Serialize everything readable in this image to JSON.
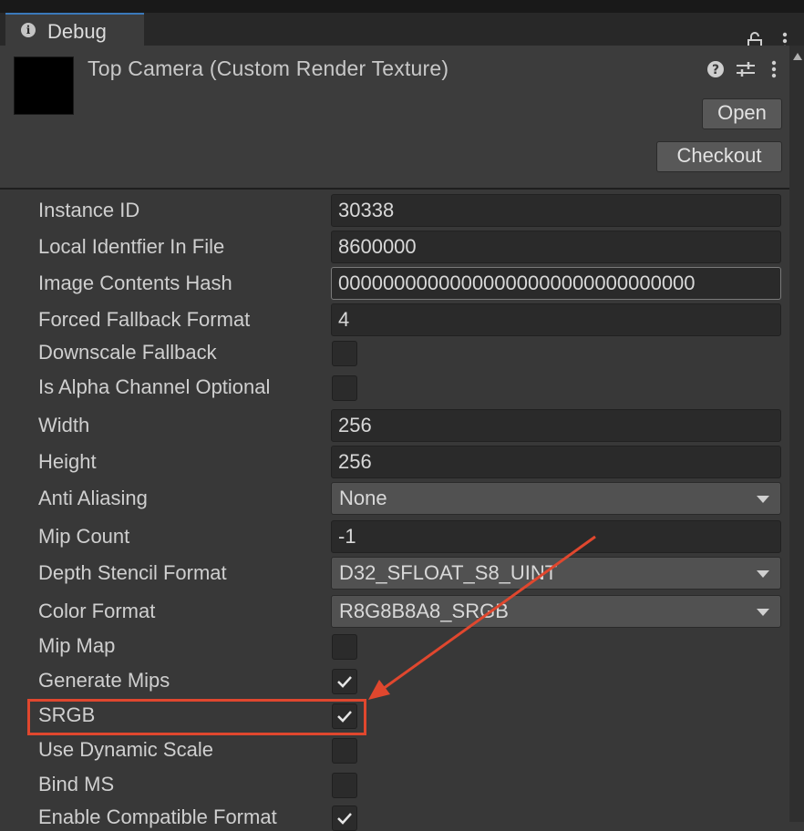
{
  "window": {
    "tab_label": "Debug",
    "tab_icon": "info-icon",
    "lock_icon": "lock-icon",
    "menu_icon": "kebab-menu-icon"
  },
  "header": {
    "title": "Top Camera (Custom Render Texture)",
    "open_label": "Open",
    "checkout_label": "Checkout",
    "icons": [
      "help-icon",
      "settings-icon",
      "menu-icon"
    ]
  },
  "properties": {
    "instance_id": {
      "label": "Instance ID",
      "value": "30338"
    },
    "local_identifier": {
      "label": "Local Identfier In File",
      "value": "8600000"
    },
    "image_hash": {
      "label": "Image Contents Hash",
      "value": "00000000000000000000000000000000"
    },
    "forced_fallback": {
      "label": "Forced Fallback Format",
      "value": "4"
    },
    "downscale_fallback": {
      "label": "Downscale Fallback",
      "checked": false
    },
    "alpha_optional": {
      "label": "Is Alpha Channel Optional",
      "checked": false
    },
    "width": {
      "label": "Width",
      "value": "256"
    },
    "height": {
      "label": "Height",
      "value": "256"
    },
    "anti_aliasing": {
      "label": "Anti Aliasing",
      "value": "None"
    },
    "mip_count": {
      "label": "Mip Count",
      "value": "-1"
    },
    "depth_stencil": {
      "label": "Depth Stencil Format",
      "value": "D32_SFLOAT_S8_UINT"
    },
    "color_format": {
      "label": "Color Format",
      "value": "R8G8B8A8_SRGB"
    },
    "mip_map": {
      "label": "Mip Map",
      "checked": false
    },
    "generate_mips": {
      "label": "Generate Mips",
      "checked": true
    },
    "srgb": {
      "label": "SRGB",
      "checked": true
    },
    "dynamic_scale": {
      "label": "Use Dynamic Scale",
      "checked": false
    },
    "bind_ms": {
      "label": "Bind MS",
      "checked": false
    },
    "compatible_format": {
      "label": "Enable Compatible Format",
      "checked": true
    }
  },
  "annotation": {
    "color": "#e0472e",
    "highlighted_row": "SRGB"
  }
}
